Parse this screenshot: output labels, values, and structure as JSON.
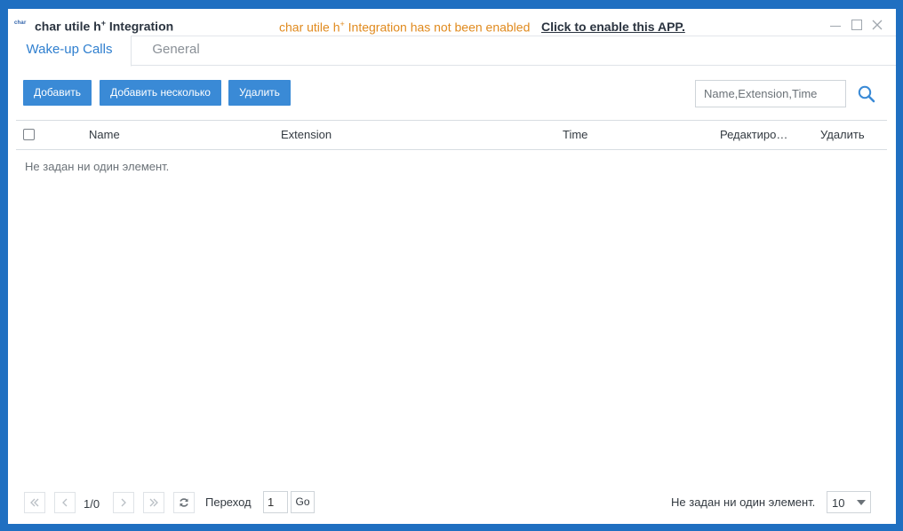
{
  "titlebar": {
    "logo_text": "char",
    "app_name": "char utile h",
    "app_name_sup": "+",
    "app_name_suffix": " Integration",
    "notice_prefix": "char utile h",
    "notice_sup": "+",
    "notice_suffix": " Integration has not been enabled",
    "enable_link": "Click to enable this APP."
  },
  "tabs": [
    {
      "label": "Wake-up Calls",
      "active": true
    },
    {
      "label": "General",
      "active": false
    }
  ],
  "toolbar": {
    "add_label": "Добавить",
    "add_multiple_label": "Добавить несколько",
    "delete_label": "Удалить"
  },
  "search": {
    "placeholder": "Name,Extension,Time",
    "value": ""
  },
  "table": {
    "columns": [
      "Name",
      "Extension",
      "Time",
      "Редактиро…",
      "Удалить"
    ],
    "rows": [],
    "empty_message": "Не задан ни один элемент."
  },
  "pager": {
    "page_info": "1/0",
    "goto_label": "Переход",
    "goto_value": "1",
    "go_label": "Go",
    "total_text": "Не задан ни один элемент.",
    "page_size": "10"
  },
  "icons": {
    "search": "search-icon",
    "refresh": "refresh-icon",
    "first": "double-chevron-left-icon",
    "prev": "chevron-left-icon",
    "next": "chevron-right-icon",
    "last": "double-chevron-right-icon"
  },
  "colors": {
    "accent": "#3a8ad6",
    "notice": "#e08a1e",
    "background": "#1f6fc1"
  }
}
